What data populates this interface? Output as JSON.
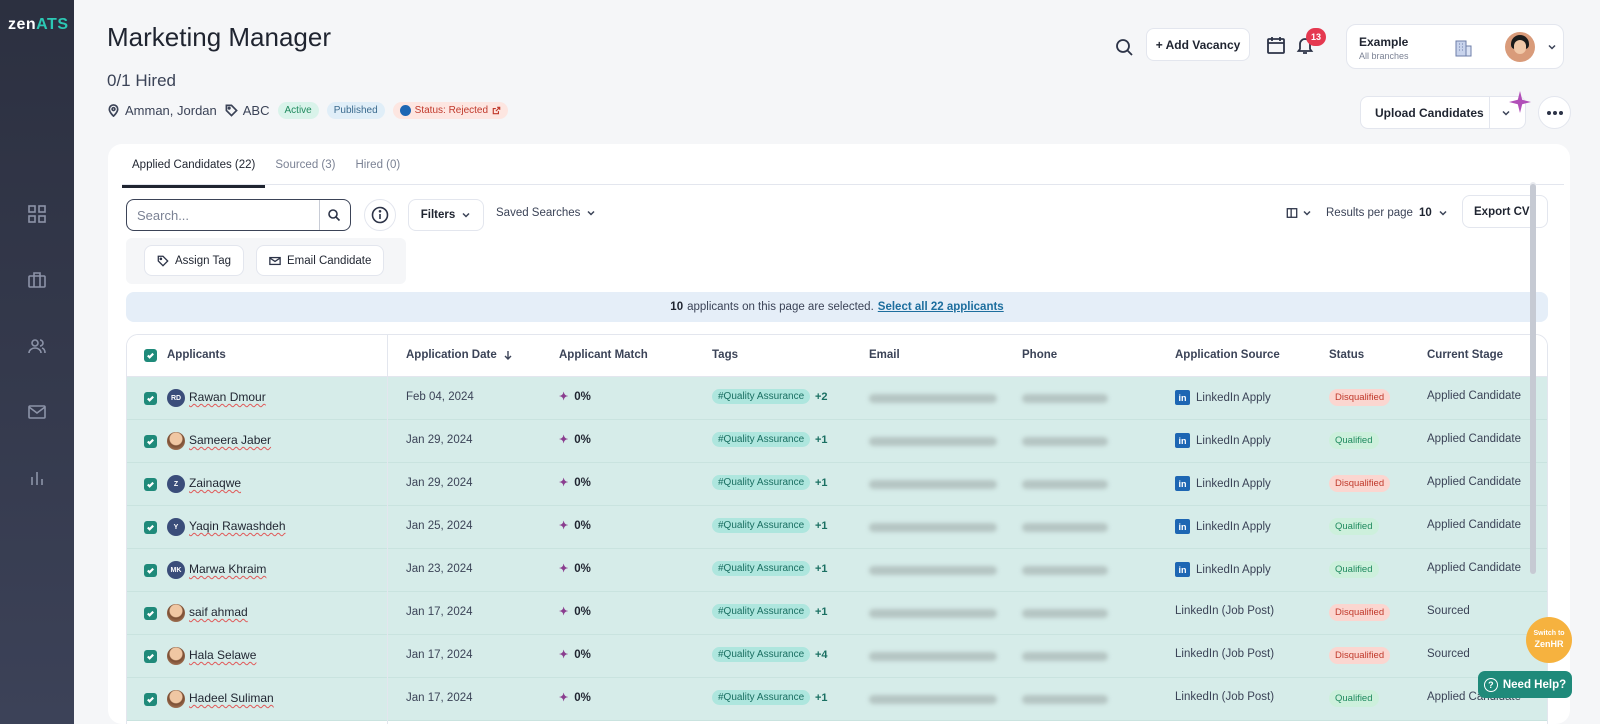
{
  "brand": {
    "logo_main": "zen",
    "logo_accent": "ATS"
  },
  "header": {
    "title": "Marketing Manager",
    "hired": "0/1 Hired",
    "location": "Amman, Jordan",
    "tag": "ABC",
    "badges": {
      "active": "Active",
      "published": "Published",
      "status": "Status: Rejected"
    },
    "add_vacancy": "+ Add Vacancy",
    "notification_count": "13",
    "org": {
      "name": "Example",
      "branches": "All branches"
    },
    "upload_candidates": "Upload Candidates"
  },
  "tabs": [
    "Applied Candidates (22)",
    "Sourced (3)",
    "Hired (0)"
  ],
  "toolbar": {
    "search_placeholder": "Search...",
    "filters": "Filters",
    "saved_searches": "Saved Searches",
    "results_per_page_label": "Results per page",
    "results_per_page_value": "10",
    "export": "Export CVs",
    "assign_tag": "Assign Tag",
    "email_candidate": "Email Candidate"
  },
  "selection_banner": {
    "count": "10",
    "text": "applicants on this page are selected.",
    "link": "Select all 22 applicants"
  },
  "table": {
    "headers": [
      "Applicants",
      "Application Date",
      "Applicant Match",
      "Tags",
      "Email",
      "Phone",
      "Application Source",
      "Status",
      "Current Stage"
    ],
    "rows": [
      {
        "initials": "RD",
        "name": "Rawan Dmour",
        "date": "Feb 04, 2024",
        "match": "0%",
        "tag": "#Quality Assurance",
        "more": "+2",
        "source": "LinkedIn Apply",
        "source_icon": true,
        "status": "Disqualified",
        "stage": "Applied Candidate"
      },
      {
        "initials": "",
        "name": "Sameera Jaber",
        "date": "Jan 29, 2024",
        "match": "0%",
        "tag": "#Quality Assurance",
        "more": "+1",
        "source": "LinkedIn Apply",
        "source_icon": true,
        "status": "Qualified",
        "stage": "Applied Candidate"
      },
      {
        "initials": "Z",
        "name": "Zainaqwe",
        "date": "Jan 29, 2024",
        "match": "0%",
        "tag": "#Quality Assurance",
        "more": "+1",
        "source": "LinkedIn Apply",
        "source_icon": true,
        "status": "Disqualified",
        "stage": "Applied Candidate"
      },
      {
        "initials": "Y",
        "name": "Yaqin Rawashdeh",
        "date": "Jan 25, 2024",
        "match": "0%",
        "tag": "#Quality Assurance",
        "more": "+1",
        "source": "LinkedIn Apply",
        "source_icon": true,
        "status": "Qualified",
        "stage": "Applied Candidate"
      },
      {
        "initials": "MK",
        "name": "Marwa Khraim",
        "date": "Jan 23, 2024",
        "match": "0%",
        "tag": "#Quality Assurance",
        "more": "+1",
        "source": "LinkedIn Apply",
        "source_icon": true,
        "status": "Qualified",
        "stage": "Applied Candidate"
      },
      {
        "initials": "",
        "name": "saif ahmad",
        "date": "Jan 17, 2024",
        "match": "0%",
        "tag": "#Quality Assurance",
        "more": "+1",
        "source": "LinkedIn (Job Post)",
        "source_icon": false,
        "status": "Disqualified",
        "stage": "Sourced"
      },
      {
        "initials": "",
        "name": "Hala Selawe",
        "date": "Jan 17, 2024",
        "match": "0%",
        "tag": "#Quality Assurance",
        "more": "+4",
        "source": "LinkedIn (Job Post)",
        "source_icon": false,
        "status": "Disqualified",
        "stage": "Sourced"
      },
      {
        "initials": "",
        "name": "Hadeel Suliman",
        "date": "Jan 17, 2024",
        "match": "0%",
        "tag": "#Quality Assurance",
        "more": "+1",
        "source": "LinkedIn (Job Post)",
        "source_icon": false,
        "status": "Qualified",
        "stage": "Applied Candidate"
      }
    ]
  },
  "floating": {
    "switch_line1": "Switch to",
    "switch_line2": "ZenHR",
    "help": "Need Help?"
  },
  "colors": {
    "accent": "#1f8a7a",
    "sidebar": "#2c3040",
    "disqualified": "#c0392b",
    "qualified": "#1f8a5e"
  }
}
